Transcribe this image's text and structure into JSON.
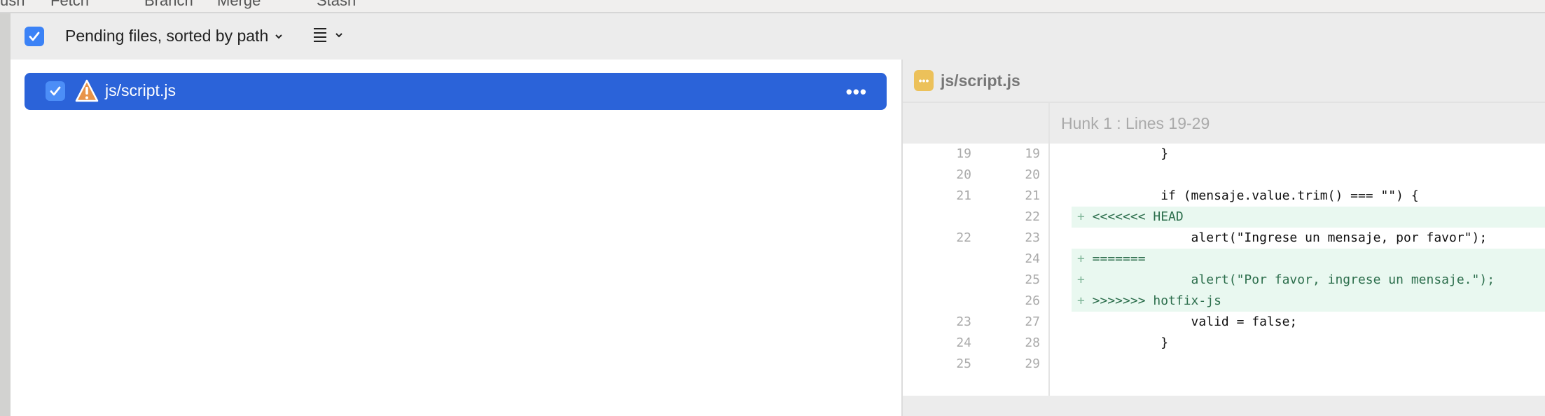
{
  "toolbar": {
    "items": [
      "ush",
      "Fetch",
      "Branch",
      "Merge",
      "Stash"
    ]
  },
  "filter": {
    "label": "Pending files, sorted by path",
    "checked": true
  },
  "files": [
    {
      "path": "js/script.js",
      "checked": true,
      "status": "conflict-warning",
      "more": "•••"
    }
  ],
  "diff": {
    "file_title": "js/script.js",
    "file_icon": "•••",
    "hunk_label": "Hunk 1 : Lines 19-29",
    "lines": [
      {
        "old": "19",
        "new": "19",
        "type": "context",
        "prefix": "",
        "code": "         }"
      },
      {
        "old": "20",
        "new": "20",
        "type": "context",
        "prefix": "",
        "code": ""
      },
      {
        "old": "21",
        "new": "21",
        "type": "context",
        "prefix": "",
        "code": "         if (mensaje.value.trim() === \"\") {"
      },
      {
        "old": "",
        "new": "22",
        "type": "add",
        "prefix": "+",
        "code": "<<<<<<< HEAD"
      },
      {
        "old": "22",
        "new": "23",
        "type": "context",
        "prefix": "",
        "code": "             alert(\"Ingrese un mensaje, por favor\");"
      },
      {
        "old": "",
        "new": "24",
        "type": "add",
        "prefix": "+",
        "code": "======="
      },
      {
        "old": "",
        "new": "25",
        "type": "add",
        "prefix": "+",
        "code": "             alert(\"Por favor, ingrese un mensaje.\");"
      },
      {
        "old": "",
        "new": "26",
        "type": "add",
        "prefix": "+",
        "code": ">>>>>>> hotfix-js"
      },
      {
        "old": "23",
        "new": "27",
        "type": "context",
        "prefix": "",
        "code": "             valid = false;"
      },
      {
        "old": "24",
        "new": "28",
        "type": "context",
        "prefix": "",
        "code": "         }"
      },
      {
        "old": "25",
        "new": "29",
        "type": "context",
        "prefix": "",
        "code": ""
      }
    ]
  },
  "colors": {
    "selection": "#2b63d9",
    "checkbox": "#3b82f6",
    "added_bg": "#e9f8f0",
    "added_text": "#2c6e4c",
    "warning": "#e8944a",
    "file_icon": "#ecc15a"
  }
}
